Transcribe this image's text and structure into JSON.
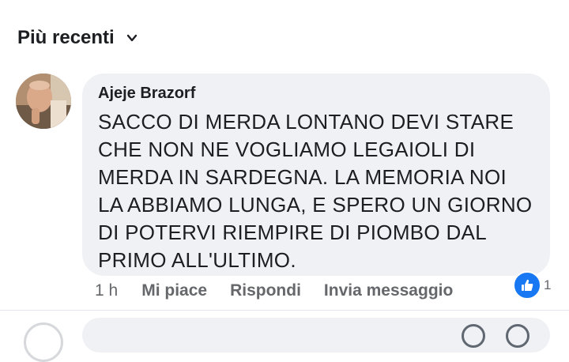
{
  "sort": {
    "label": "Più recenti",
    "icon": "chevron-down-icon"
  },
  "comment": {
    "author": "Ajeje Brazorf",
    "text": "SACCO DI MERDA LONTANO DEVI STARE\nCHE NON NE VOGLIAMO LEGAIOLI DI\nMERDA IN SARDEGNA. LA MEMORIA NOI\nLA ABBIAMO LUNGA, E SPERO UN GIORNO\nDI POTERVI RIEMPIRE DI PIOMBO DAL\nPRIMO ALL'ULTIMO.",
    "time": "1 h",
    "actions": {
      "like": "Mi piace",
      "reply": "Rispondi",
      "message": "Invia messaggio"
    },
    "reactions": {
      "icon": "thumbs-up-icon",
      "count": "1"
    }
  },
  "reply_box": {
    "placeholder": ""
  },
  "colors": {
    "bubble": "#eff1f4",
    "text": "#1c1e21",
    "muted": "#65676b",
    "accent": "#1877f2"
  }
}
